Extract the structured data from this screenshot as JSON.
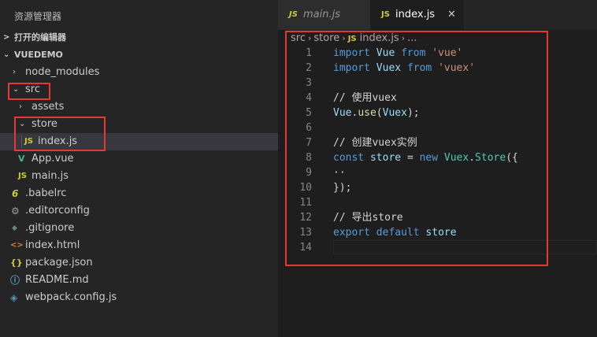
{
  "sidebar": {
    "title": "资源管理器",
    "open_editors": "打开的编辑器",
    "project": "VUEDEMO",
    "tree": [
      {
        "label": "node_modules",
        "chev": "›"
      },
      {
        "label": "src",
        "chev": "⌄"
      },
      {
        "label": "assets",
        "chev": "›"
      },
      {
        "label": "store",
        "chev": "⌄"
      },
      {
        "label": "index.js",
        "icon": "JS"
      },
      {
        "label": "App.vue",
        "icon": "V"
      },
      {
        "label": "main.js",
        "icon": "JS"
      },
      {
        "label": ".babelrc",
        "icon": "6"
      },
      {
        "label": ".editorconfig",
        "icon": "⚙"
      },
      {
        "label": ".gitignore",
        "icon": "◆"
      },
      {
        "label": "index.html",
        "icon": "<>"
      },
      {
        "label": "package.json",
        "icon": "{}"
      },
      {
        "label": "README.md",
        "icon": "ⓘ"
      },
      {
        "label": "webpack.config.js",
        "icon": "◈"
      }
    ]
  },
  "tabs": [
    {
      "label": "main.js",
      "icon": "JS"
    },
    {
      "label": "index.js",
      "icon": "JS",
      "close": "✕"
    }
  ],
  "breadcrumb": [
    "src",
    "store",
    "index.js",
    "..."
  ],
  "breadcrumb_sep": "›",
  "editor": {
    "line_numbers": [
      "1",
      "2",
      "3",
      "4",
      "5",
      "6",
      "7",
      "8",
      "9",
      "10",
      "11",
      "12",
      "13",
      "14"
    ],
    "l1": [
      "import",
      "Vue",
      "from",
      "'vue'"
    ],
    "l2": [
      "import",
      "Vuex",
      "from",
      "'vuex'"
    ],
    "l4": "// 使用vuex",
    "l5": [
      "Vue",
      ".",
      "use",
      "(",
      "Vuex",
      ");"
    ],
    "l7": "// 创建vuex实例",
    "l8": [
      "const",
      "store",
      "=",
      "new",
      "Vuex",
      ".",
      "Store",
      "({"
    ],
    "l9": "··",
    "l10": "});",
    "l12": "// 导出store",
    "l13": [
      "export",
      "default",
      "store"
    ]
  },
  "colors": {
    "keyword": "#569cd6",
    "string": "#ce9178",
    "comment": "#6a9955",
    "highlight_box": "#e53935",
    "js_icon": "#cbcb41",
    "vue_icon": "#41b883"
  }
}
